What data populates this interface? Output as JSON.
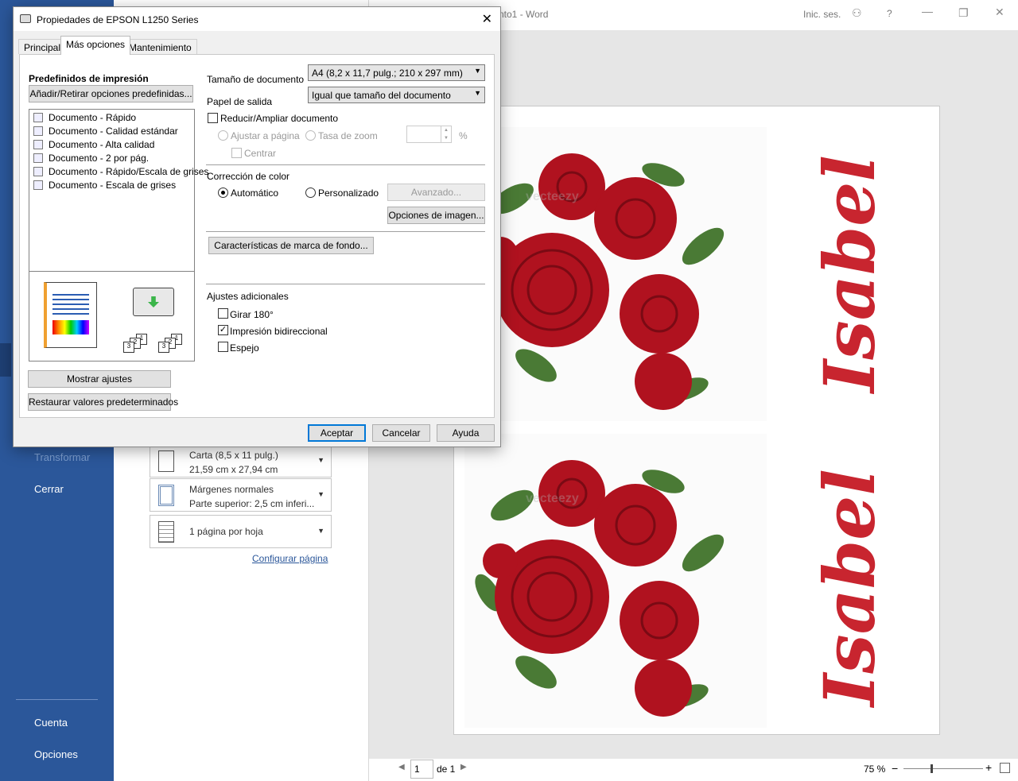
{
  "word": {
    "title": "nto1 - Word",
    "signin": "Inic. ses.",
    "help": "?",
    "sidebar": {
      "transformar": "Transformar",
      "cerrar": "Cerrar",
      "cuenta": "Cuenta",
      "opciones": "Opciones"
    },
    "settings": {
      "paper_line1": "Carta (8,5 x 11 pulg.)",
      "paper_line2": "21,59 cm x 27,94 cm",
      "margins_line1": "Márgenes normales",
      "margins_line2": "Parte superior: 2,5 cm inferi...",
      "pages_per_sheet": "1 página por hoja",
      "config_link": "Configurar página"
    },
    "preview": {
      "name_top": "Isabel",
      "name_bottom": "Isabel",
      "watermark": "vecteezy"
    },
    "status": {
      "page_value": "1",
      "page_of": "de 1",
      "zoom": "75 %",
      "minus": "−",
      "plus": "+"
    }
  },
  "dialog": {
    "title": "Propiedades de EPSON L1250 Series",
    "close": "✕",
    "tabs": [
      "Principal",
      "Más opciones",
      "Mantenimiento"
    ],
    "presets_header": "Predefinidos de impresión",
    "add_remove_button": "Añadir/Retirar opciones predefinidas...",
    "presets": [
      "Documento - Rápido",
      "Documento - Calidad estándar",
      "Documento - Alta calidad",
      "Documento - 2 por pág.",
      "Documento - Rápido/Escala de grises",
      "Documento - Escala de grises"
    ],
    "show_settings_button": "Mostrar ajustes",
    "restore_defaults_button": "Restaurar valores predeterminados",
    "doc_size_label": "Tamaño de documento",
    "doc_size_value": "A4 (8,2 x 11,7 pulg.; 210 x 297 mm)",
    "output_paper_label": "Papel de salida",
    "output_paper_value": "Igual que tamaño del documento",
    "reduce_enlarge": "Reducir/Ampliar documento",
    "fit_page": "Ajustar a página",
    "zoom_rate": "Tasa de zoom",
    "percent": "%",
    "center": "Centrar",
    "color_correction": "Corrección de color",
    "automatic": "Automático",
    "custom": "Personalizado",
    "advanced_button": "Avanzado...",
    "image_options_button": "Opciones de imagen...",
    "watermark_button": "Características de marca de fondo...",
    "additional_settings": "Ajustes adicionales",
    "rotate_180": "Girar 180°",
    "bidirectional": "Impresión bidireccional",
    "mirror": "Espejo",
    "ok_button": "Aceptar",
    "cancel_button": "Cancelar",
    "help_button": "Ayuda",
    "stack_labels": [
      "3",
      "2",
      "1"
    ]
  }
}
